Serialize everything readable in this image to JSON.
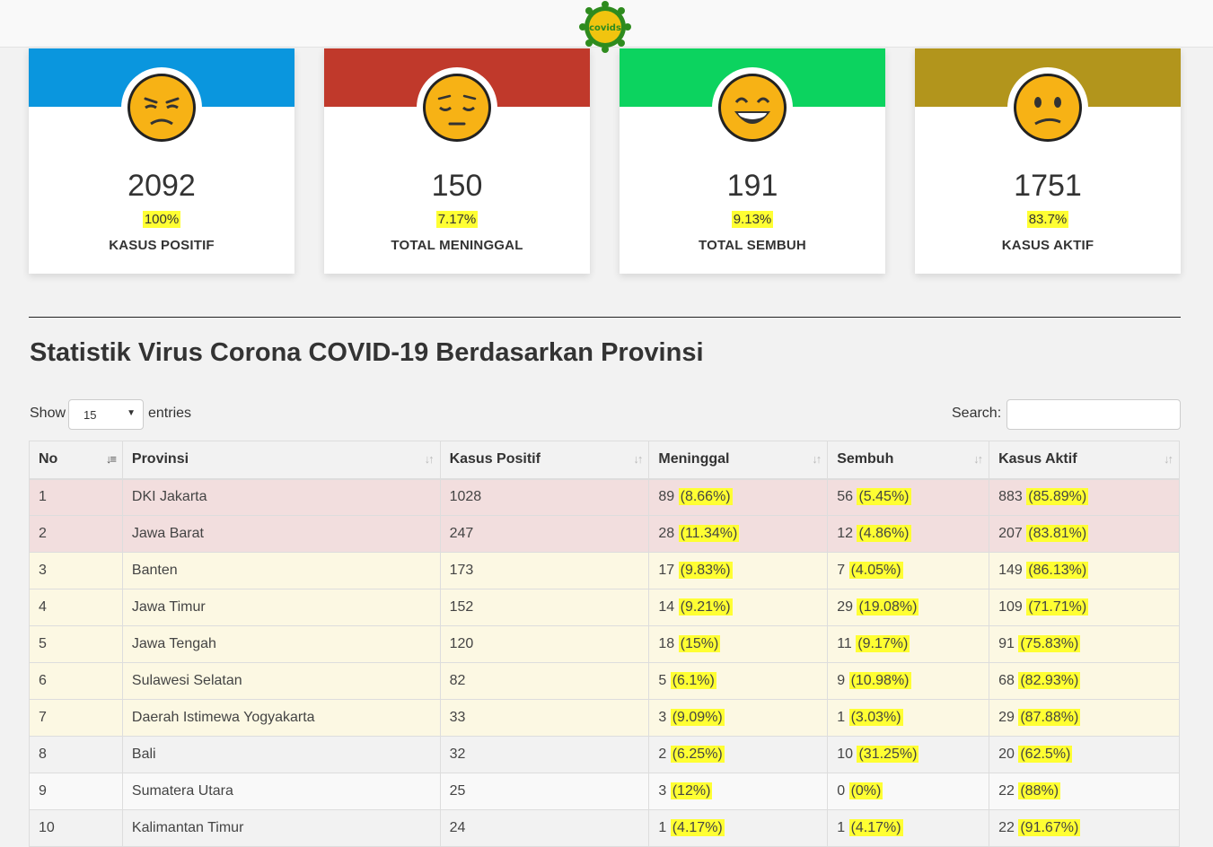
{
  "logo": {
    "text": "covids"
  },
  "cards": [
    {
      "value": "2092",
      "percent": "100%",
      "label": "KASUS POSITIF",
      "band_color": "#0a96de",
      "face": "anxious-face-icon"
    },
    {
      "value": "150",
      "percent": "7.17%",
      "label": "TOTAL MENINGGAL",
      "band_color": "#c0392b",
      "face": "relieved-face-icon"
    },
    {
      "value": "191",
      "percent": "9.13%",
      "label": "TOTAL SEMBUH",
      "band_color": "#0cd35f",
      "face": "grinning-face-icon"
    },
    {
      "value": "1751",
      "percent": "83.7%",
      "label": "KASUS AKTIF",
      "band_color": "#b2951c",
      "face": "confused-face-icon"
    }
  ],
  "heading": "Statistik Virus Corona COVID-19 Berdasarkan Provinsi",
  "controls": {
    "show": "Show",
    "page_size": "15",
    "entries": "entries",
    "search_label": "Search:",
    "search_value": ""
  },
  "table": {
    "headers": [
      "No",
      "Provinsi",
      "Kasus Positif",
      "Meninggal",
      "Sembuh",
      "Kasus Aktif"
    ],
    "rows": [
      {
        "no": "1",
        "prov": "DKI Jakarta",
        "pos": "1028",
        "m": "89",
        "mp": "(8.66%)",
        "s": "56",
        "sp": "(5.45%)",
        "a": "883",
        "ap": "(85.89%)",
        "style": "danger"
      },
      {
        "no": "2",
        "prov": "Jawa Barat",
        "pos": "247",
        "m": "28",
        "mp": "(11.34%)",
        "s": "12",
        "sp": "(4.86%)",
        "a": "207",
        "ap": "(83.81%)",
        "style": "danger"
      },
      {
        "no": "3",
        "prov": "Banten",
        "pos": "173",
        "m": "17",
        "mp": "(9.83%)",
        "s": "7",
        "sp": "(4.05%)",
        "a": "149",
        "ap": "(86.13%)",
        "style": "warning"
      },
      {
        "no": "4",
        "prov": "Jawa Timur",
        "pos": "152",
        "m": "14",
        "mp": "(9.21%)",
        "s": "29",
        "sp": "(19.08%)",
        "a": "109",
        "ap": "(71.71%)",
        "style": "warning"
      },
      {
        "no": "5",
        "prov": "Jawa Tengah",
        "pos": "120",
        "m": "18",
        "mp": "(15%)",
        "s": "11",
        "sp": "(9.17%)",
        "a": "91",
        "ap": "(75.83%)",
        "style": "warning"
      },
      {
        "no": "6",
        "prov": "Sulawesi Selatan",
        "pos": "82",
        "m": "5",
        "mp": "(6.1%)",
        "s": "9",
        "sp": "(10.98%)",
        "a": "68",
        "ap": "(82.93%)",
        "style": "warning"
      },
      {
        "no": "7",
        "prov": "Daerah Istimewa Yogyakarta",
        "pos": "33",
        "m": "3",
        "mp": "(9.09%)",
        "s": "1",
        "sp": "(3.03%)",
        "a": "29",
        "ap": "(87.88%)",
        "style": "warning"
      },
      {
        "no": "8",
        "prov": "Bali",
        "pos": "32",
        "m": "2",
        "mp": "(6.25%)",
        "s": "10",
        "sp": "(31.25%)",
        "a": "20",
        "ap": "(62.5%)",
        "style": "even"
      },
      {
        "no": "9",
        "prov": "Sumatera Utara",
        "pos": "25",
        "m": "3",
        "mp": "(12%)",
        "s": "0",
        "sp": "(0%)",
        "a": "22",
        "ap": "(88%)",
        "style": "odd"
      },
      {
        "no": "10",
        "prov": "Kalimantan Timur",
        "pos": "24",
        "m": "1",
        "mp": "(4.17%)",
        "s": "1",
        "sp": "(4.17%)",
        "a": "22",
        "ap": "(91.67%)",
        "style": "even"
      }
    ]
  }
}
